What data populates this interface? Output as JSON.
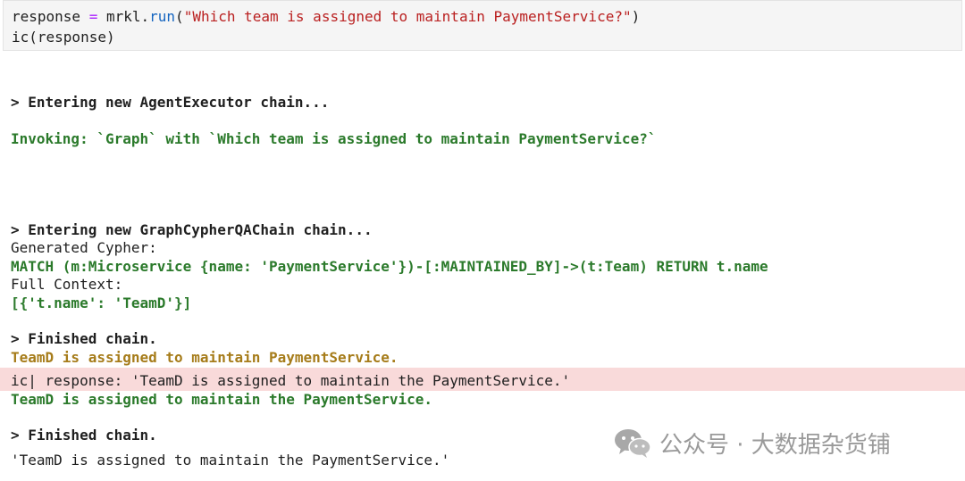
{
  "input_cell": {
    "line1": {
      "var": "response ",
      "op": "=",
      "pre_call": " mrkl.",
      "call": "run",
      "open": "(",
      "str": "\"Which team is assigned to maintain PaymentService?\"",
      "close": ")"
    },
    "line2": "ic(response)"
  },
  "output": {
    "agent_entry": "> Entering new AgentExecutor chain...",
    "invoking": "Invoking: `Graph` with `Which team is assigned to maintain PaymentService?`",
    "graph_entry": "> Entering new GraphCypherQAChain chain...",
    "generated_label": "Generated Cypher:",
    "cypher": "MATCH (m:Microservice {name: 'PaymentService'})-[:MAINTAINED_BY]->(t:Team) RETURN t.name",
    "context_label": "Full Context:",
    "context_value": "[{'t.name': 'TeamD'}]",
    "finished_1": "> Finished chain.",
    "inner_answer": "TeamD is assigned to maintain PaymentService.",
    "ic_line": "ic| response: 'TeamD is assigned to maintain the PaymentService.'",
    "agent_answer": "TeamD is assigned to maintain the PaymentService.",
    "finished_2": "> Finished chain.",
    "final_value": "'TeamD is assigned to maintain the PaymentService.'"
  },
  "watermark": {
    "text": "公众号 · 大数据杂货铺",
    "icon": "wechat-icon"
  },
  "colors": {
    "green": "#2b7a2b",
    "olive": "#a67c1a",
    "ic_band": "#f9dada",
    "string": "#ba2121",
    "operator": "#aa22ff",
    "call": "#1565c0"
  }
}
